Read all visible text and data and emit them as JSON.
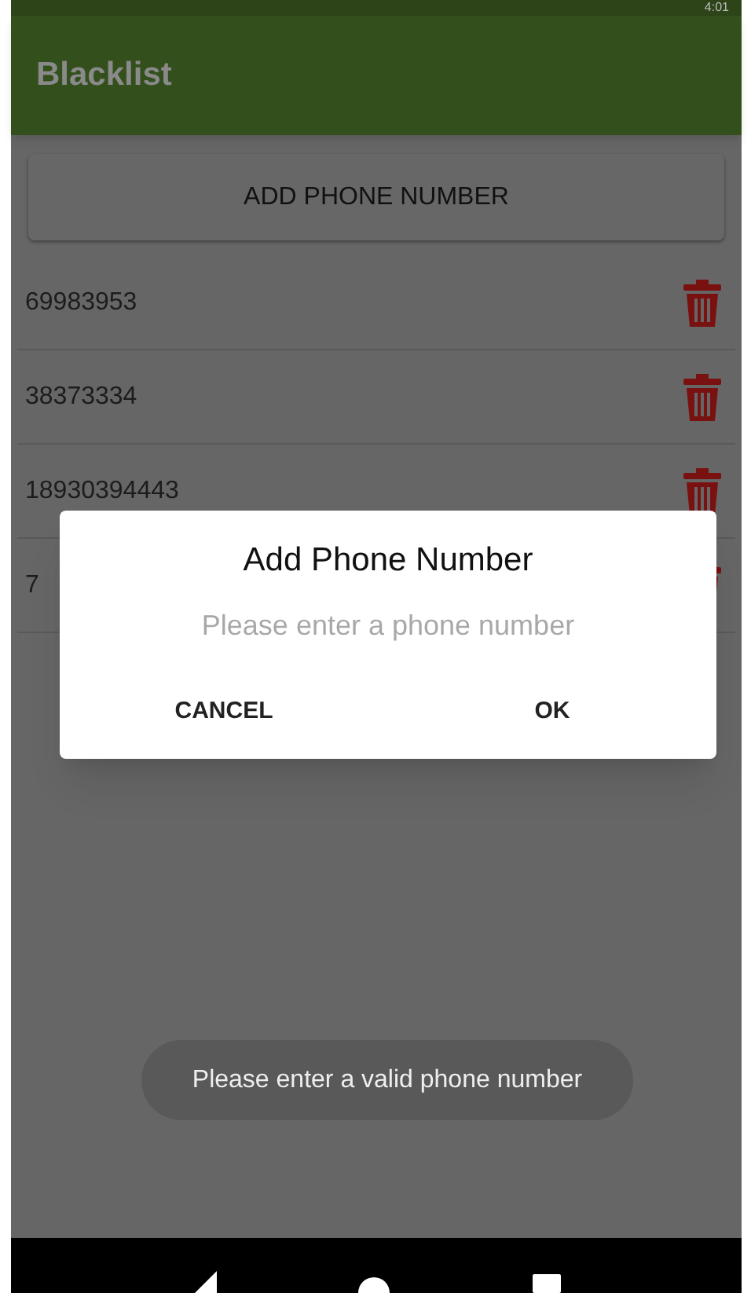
{
  "status_bar": {
    "time": "4:01"
  },
  "app_bar": {
    "title": "Blacklist"
  },
  "add_button": {
    "label": "ADD PHONE NUMBER"
  },
  "numbers": [
    {
      "number": "69983953"
    },
    {
      "number": "38373334"
    },
    {
      "number": "18930394443"
    },
    {
      "number": "7"
    }
  ],
  "dialog": {
    "title": "Add Phone Number",
    "field": {
      "placeholder": "Please enter a phone number"
    },
    "buttons": [
      "CANCEL",
      "OK"
    ]
  },
  "toast": {
    "message": "Please enter a valid phone number"
  }
}
